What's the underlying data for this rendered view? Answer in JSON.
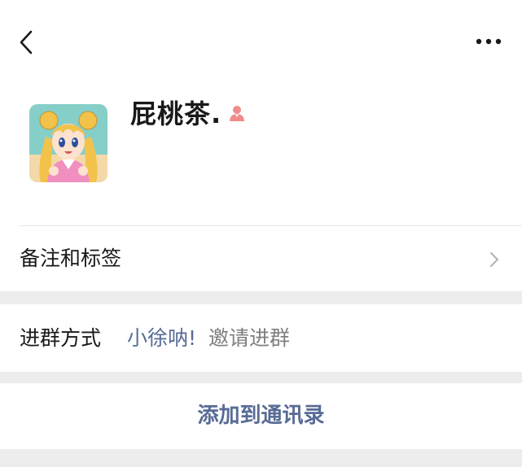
{
  "profile": {
    "nickname": "屁桃茶.",
    "gender_icon": "female-gender-icon",
    "avatar_icon": "anime-avatar"
  },
  "nav": {
    "back_icon": "chevron-left-icon",
    "more_icon": "more-dots-icon"
  },
  "remark_row": {
    "label": "备注和标签",
    "chevron_icon": "chevron-right-icon"
  },
  "join_row": {
    "label": "进群方式",
    "inviter": "小徐呐!",
    "suffix": "邀请进群"
  },
  "add_contact": {
    "label": "添加到通讯录"
  },
  "colors": {
    "link": "#576b95",
    "background": "#ededed",
    "card": "#ffffff",
    "gender_icon": "#f08b8b"
  }
}
